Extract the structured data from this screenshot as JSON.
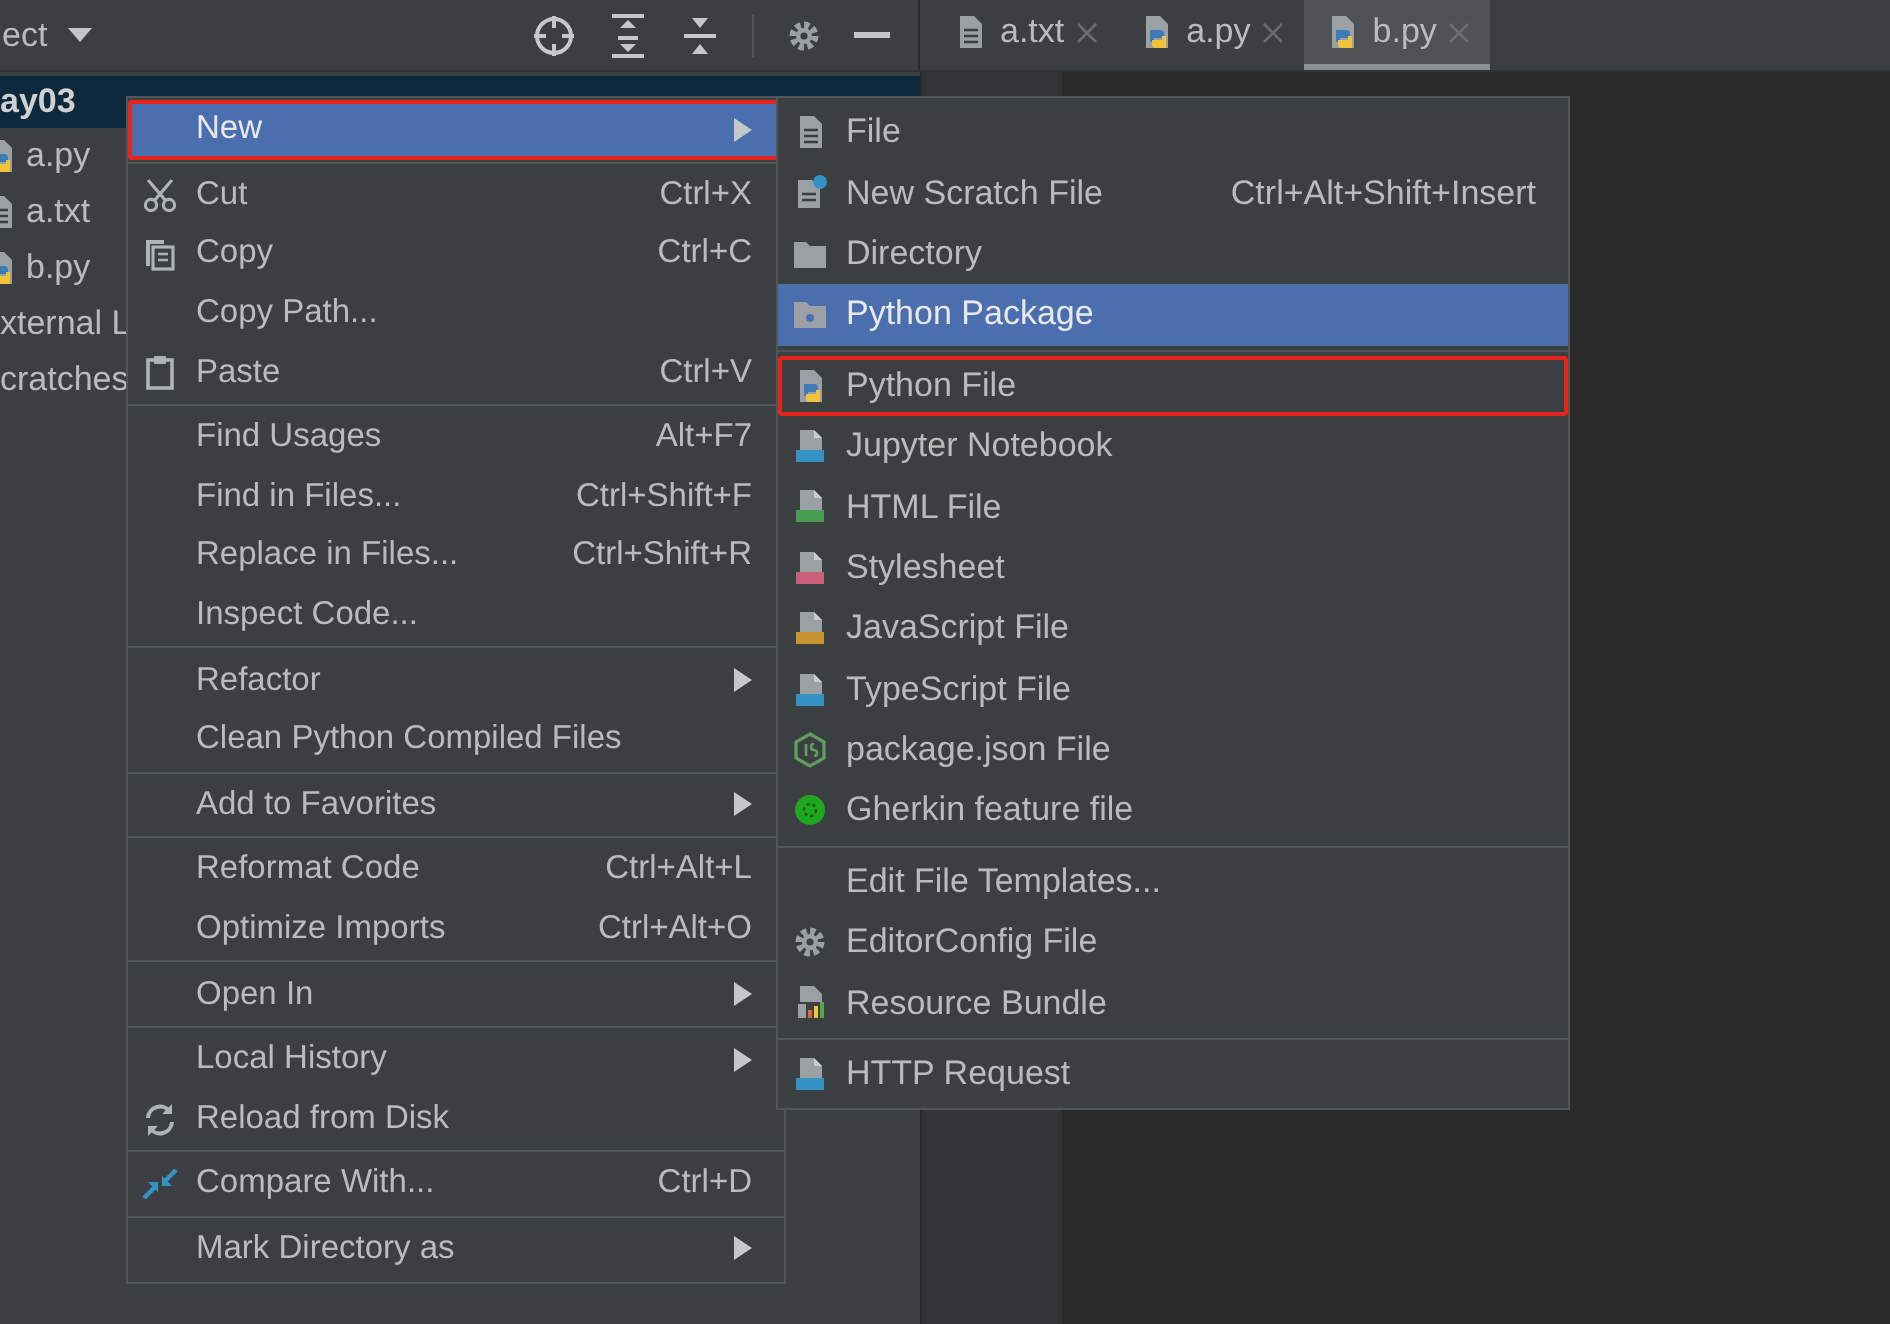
{
  "project_panel": {
    "title": "ect",
    "tree": {
      "name": "ay03",
      "selected": true,
      "children": [
        {
          "name": "a.py",
          "kind": "python"
        },
        {
          "name": "a.txt",
          "kind": "text"
        },
        {
          "name": "b.py",
          "kind": "python"
        }
      ]
    },
    "extra_nodes": [
      {
        "name": "xternal L"
      },
      {
        "name": "cratches"
      }
    ]
  },
  "tabs": [
    {
      "label": "a.txt",
      "kind": "text",
      "selected": false
    },
    {
      "label": "a.py",
      "kind": "python",
      "selected": false
    },
    {
      "label": "b.py",
      "kind": "python",
      "selected": true
    }
  ],
  "context_menu": {
    "groups": [
      {
        "items": [
          {
            "label": "New",
            "kind": "none",
            "submenu": true,
            "selected": true,
            "outlined": true
          }
        ]
      },
      {
        "items": [
          {
            "label": "Cut",
            "kind": "cut",
            "shortcut": "Ctrl+X",
            "selected": false
          },
          {
            "label": "Copy",
            "kind": "copy",
            "shortcut": "Ctrl+C",
            "selected": false
          },
          {
            "label": "Copy Path...",
            "kind": "none",
            "selected": false
          },
          {
            "label": "Paste",
            "kind": "paste",
            "shortcut": "Ctrl+V",
            "selected": false
          }
        ]
      },
      {
        "items": [
          {
            "label": "Find Usages",
            "kind": "none",
            "shortcut": "Alt+F7",
            "selected": false
          },
          {
            "label": "Find in Files...",
            "kind": "none",
            "shortcut": "Ctrl+Shift+F",
            "selected": false
          },
          {
            "label": "Replace in Files...",
            "kind": "none",
            "shortcut": "Ctrl+Shift+R",
            "selected": false
          },
          {
            "label": "Inspect Code...",
            "kind": "none",
            "selected": false
          }
        ]
      },
      {
        "items": [
          {
            "label": "Refactor",
            "kind": "none",
            "submenu": true,
            "selected": false
          },
          {
            "label": "Clean Python Compiled Files",
            "kind": "none",
            "selected": false
          }
        ]
      },
      {
        "items": [
          {
            "label": "Add to Favorites",
            "kind": "none",
            "submenu": true,
            "selected": false
          }
        ]
      },
      {
        "items": [
          {
            "label": "Reformat Code",
            "kind": "none",
            "shortcut": "Ctrl+Alt+L",
            "selected": false
          },
          {
            "label": "Optimize Imports",
            "kind": "none",
            "shortcut": "Ctrl+Alt+O",
            "selected": false
          }
        ]
      },
      {
        "items": [
          {
            "label": "Open In",
            "kind": "none",
            "submenu": true,
            "selected": false
          }
        ]
      },
      {
        "items": [
          {
            "label": "Local History",
            "kind": "none",
            "submenu": true,
            "selected": false
          },
          {
            "label": "Reload from Disk",
            "kind": "reload",
            "selected": false
          }
        ]
      },
      {
        "items": [
          {
            "label": "Compare With...",
            "kind": "compare",
            "shortcut": "Ctrl+D",
            "selected": false
          }
        ]
      },
      {
        "items": [
          {
            "label": "Mark Directory as",
            "kind": "none",
            "submenu": true,
            "selected": false
          }
        ]
      }
    ]
  },
  "new_submenu": {
    "groups": [
      {
        "items": [
          {
            "label": "File",
            "kind": "file",
            "selected": false
          },
          {
            "label": "New Scratch File",
            "kind": "scratch",
            "shortcut": "Ctrl+Alt+Shift+Insert",
            "selected": false
          },
          {
            "label": "Directory",
            "kind": "folder",
            "selected": false
          },
          {
            "label": "Python Package",
            "kind": "package",
            "selected": true
          }
        ]
      },
      {
        "items": [
          {
            "label": "Python File",
            "kind": "python",
            "selected": false,
            "outlined": true
          },
          {
            "label": "Jupyter Notebook",
            "kind": "notebook",
            "selected": false
          },
          {
            "label": "HTML File",
            "kind": "html",
            "selected": false
          },
          {
            "label": "Stylesheet",
            "kind": "css",
            "selected": false
          },
          {
            "label": "JavaScript File",
            "kind": "js",
            "selected": false
          },
          {
            "label": "TypeScript File",
            "kind": "ts",
            "selected": false
          },
          {
            "label": "package.json File",
            "kind": "node",
            "selected": false
          },
          {
            "label": "Gherkin feature file",
            "kind": "gherkin",
            "selected": false
          }
        ]
      },
      {
        "items": [
          {
            "label": "Edit File Templates...",
            "kind": "none",
            "selected": false
          },
          {
            "label": "EditorConfig File",
            "kind": "gear",
            "selected": false
          },
          {
            "label": "Resource Bundle",
            "kind": "bundle",
            "selected": false
          }
        ]
      },
      {
        "items": [
          {
            "label": "HTTP Request",
            "kind": "http",
            "selected": false
          }
        ]
      }
    ]
  }
}
